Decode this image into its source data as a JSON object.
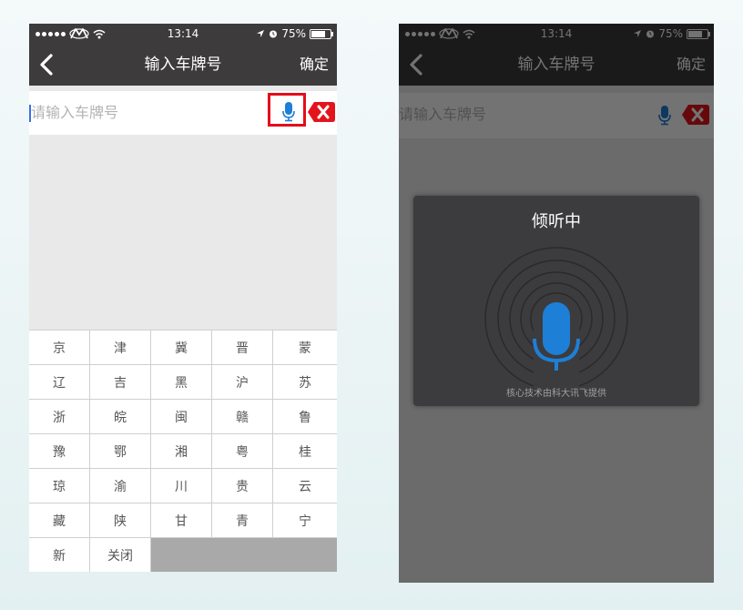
{
  "status_bar": {
    "time": "13:14",
    "battery_text": "75%",
    "battery_level": 0.75
  },
  "nav": {
    "title": "输入车牌号",
    "confirm_label": "确定"
  },
  "input": {
    "placeholder": "请输入车牌号",
    "value": ""
  },
  "keyboard": {
    "rows": [
      [
        "京",
        "津",
        "冀",
        "晋",
        "蒙"
      ],
      [
        "辽",
        "吉",
        "黑",
        "沪",
        "苏"
      ],
      [
        "浙",
        "皖",
        "闽",
        "赣",
        "鲁"
      ],
      [
        "豫",
        "鄂",
        "湘",
        "粤",
        "桂"
      ],
      [
        "琼",
        "渝",
        "川",
        "贵",
        "云"
      ],
      [
        "藏",
        "陕",
        "甘",
        "青",
        "宁"
      ],
      [
        "新",
        "关闭"
      ]
    ]
  },
  "voice_dialog": {
    "title": "倾听中",
    "credit": "核心技术由科大讯飞提供"
  },
  "colors": {
    "bar_bg": "#3d3b3c",
    "mic_blue": "#1e7fd6",
    "highlight_red": "#e30d1a",
    "clear_red": "#e3141c"
  },
  "icons": {
    "back": "chevron-left-icon",
    "mic": "microphone-icon",
    "clear": "clear-delete-icon",
    "signal": "signal-dots-icon",
    "carrier": "carrier-logo-icon",
    "wifi": "wifi-icon",
    "location": "location-arrow-icon",
    "alarm": "alarm-icon",
    "battery": "battery-icon"
  }
}
